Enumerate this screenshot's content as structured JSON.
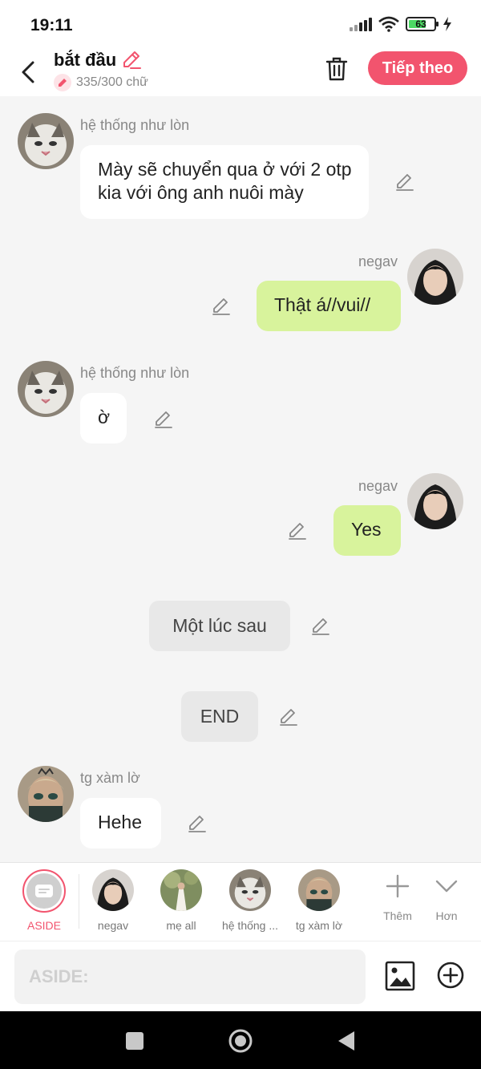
{
  "status_bar": {
    "time": "19:11",
    "battery": "63"
  },
  "header": {
    "title": "bắt đầu",
    "word_count": "335/300 chữ",
    "next_label": "Tiếp theo"
  },
  "messages": [
    {
      "sender": "hệ thống như lòn",
      "text": "Mày sẽ chuyển qua ở với 2 otp kia với ông anh nuôi mày"
    },
    {
      "sender": "negav",
      "text": "Thật á//vui//"
    },
    {
      "sender": "hệ thống như lòn",
      "text": "ờ"
    },
    {
      "sender": "negav",
      "text": "Yes"
    },
    {
      "text": "Một lúc sau"
    },
    {
      "text": "END"
    },
    {
      "sender": "tg xàm lờ",
      "text": "Hehe"
    }
  ],
  "characters": [
    {
      "name": "ASIDE"
    },
    {
      "name": "negav"
    },
    {
      "name": "mẹ all"
    },
    {
      "name": "hệ thống ..."
    },
    {
      "name": "tg xàm lờ"
    }
  ],
  "tools": {
    "more_label": "Thêm",
    "expand_label": "Hơn"
  },
  "input": {
    "placeholder": "ASIDE:"
  },
  "colors": {
    "accent": "#f2546e",
    "right_bubble": "#d8f39c",
    "left_bubble": "#ffffff",
    "center_bubble": "#e8e8e8",
    "background": "#f5f5f5"
  },
  "icons": [
    "back-arrow-icon",
    "edit-pencil-icon",
    "trash-icon",
    "image-icon",
    "plus-circle-icon",
    "add-icon",
    "chevron-down-icon",
    "square-nav-icon",
    "home-nav-icon",
    "back-nav-icon",
    "wifi-icon",
    "signal-icon",
    "battery-icon",
    "charging-icon"
  ]
}
